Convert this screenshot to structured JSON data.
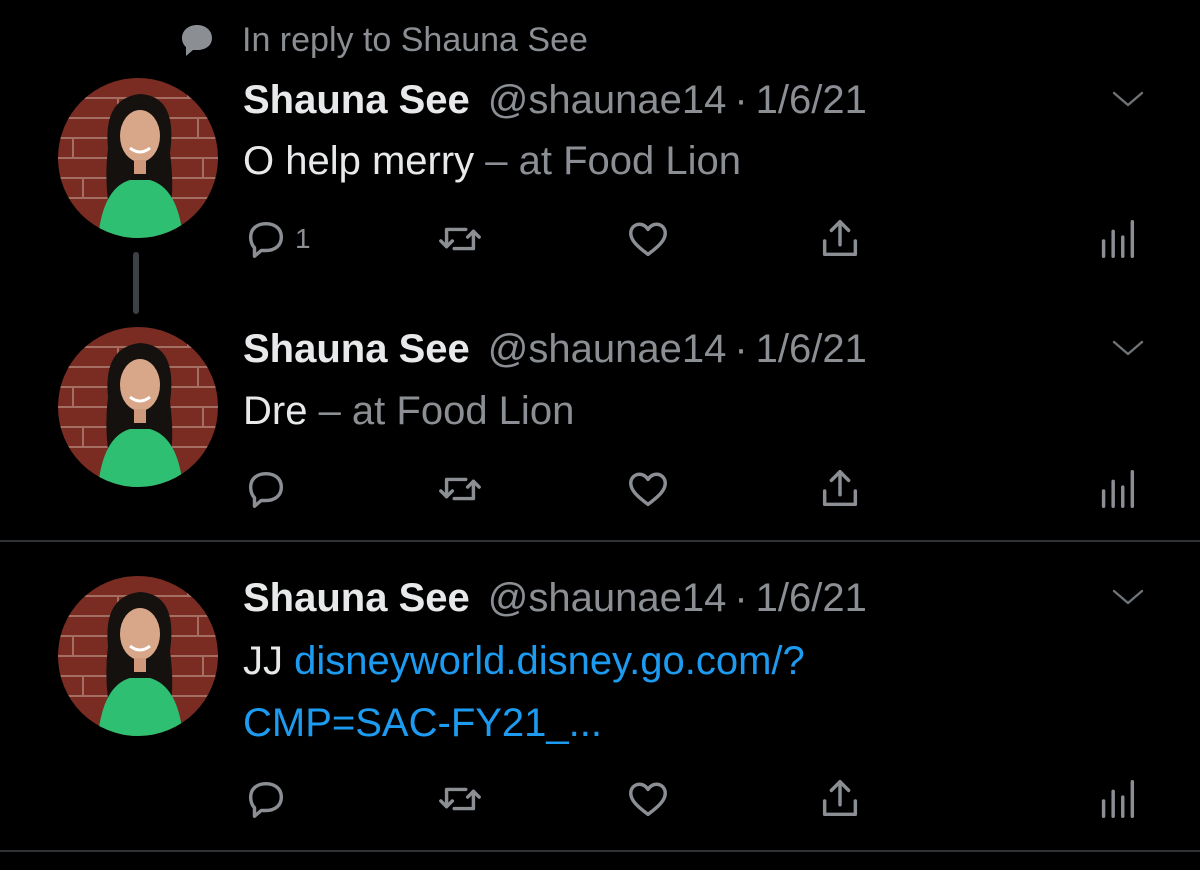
{
  "reply_context": {
    "icon": "speech-bubble-icon",
    "text": "In reply to Shauna See"
  },
  "tweets": [
    {
      "name": "Shauna See",
      "handle": "@shaunae14",
      "separator": "·",
      "date": "1/6/21",
      "text": "O help merry",
      "location": " – at Food Lion",
      "reply_count": "1"
    },
    {
      "name": "Shauna See",
      "handle": "@shaunae14",
      "separator": "·",
      "date": "1/6/21",
      "text": "Dre",
      "location": " – at Food Lion",
      "reply_count": ""
    },
    {
      "name": "Shauna See",
      "handle": "@shaunae14",
      "separator": "·",
      "date": "1/6/21",
      "text": "JJ ",
      "link_line1": "disneyworld.disney.go.com/?",
      "link_line2": "CMP=SAC-FY21_...",
      "reply_count": ""
    }
  ],
  "colors": {
    "background": "#000000",
    "text": "#e7e9ea",
    "muted": "#8b8f94",
    "link": "#1d9bf0",
    "divider": "#2f3336"
  },
  "icons": {
    "reply": "reply-icon",
    "retweet": "retweet-icon",
    "like": "heart-icon",
    "share": "share-icon",
    "stats": "stats-icon",
    "menu": "chevron-down-icon"
  }
}
